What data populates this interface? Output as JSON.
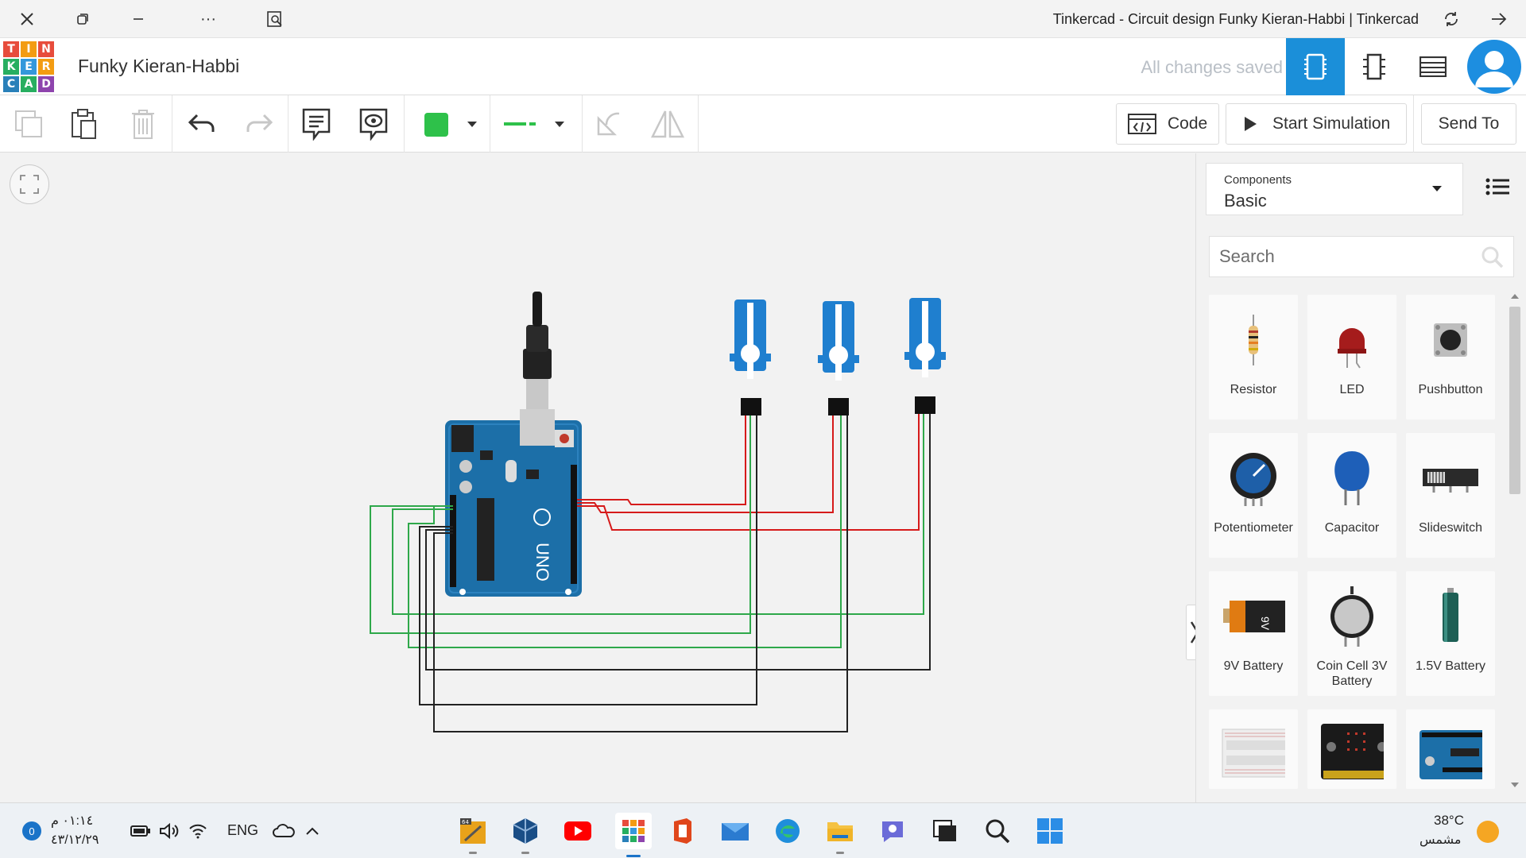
{
  "browser": {
    "title": "Tinkercad - Circuit design Funky Kieran-Habbi | Tinkercad",
    "more_label": "···"
  },
  "header": {
    "logo_letters": [
      "T",
      "I",
      "N",
      "K",
      "E",
      "R",
      "C",
      "A",
      "D"
    ],
    "logo_colors": [
      "#e74c3c",
      "#f39c12",
      "#e74c3c",
      "#27ae60",
      "#3498db",
      "#f39c12",
      "#2980b9",
      "#27ae60",
      "#8e44ad"
    ],
    "project_name": "Funky Kieran-Habbi",
    "save_status": "All changes saved",
    "views": [
      "circuit-view-icon",
      "schematic-view-icon",
      "component-list-icon"
    ],
    "accent": "#1b8fd9"
  },
  "toolbar": {
    "code_label": "Code",
    "simulate_label": "Start Simulation",
    "send_label": "Send To",
    "wire_color": "#2ec14a"
  },
  "panel": {
    "components_label": "Components",
    "category": "Basic",
    "search_placeholder": "Search",
    "items": [
      {
        "label": "Resistor",
        "icon": "resistor-icon"
      },
      {
        "label": "LED",
        "icon": "led-icon"
      },
      {
        "label": "Pushbutton",
        "icon": "pushbutton-icon"
      },
      {
        "label": "Potentiometer",
        "icon": "potentiometer-icon"
      },
      {
        "label": "Capacitor",
        "icon": "capacitor-icon"
      },
      {
        "label": "Slideswitch",
        "icon": "slideswitch-icon"
      },
      {
        "label": "9V Battery",
        "icon": "battery-9v-icon"
      },
      {
        "label": "Coin Cell 3V Battery",
        "icon": "coin-cell-icon"
      },
      {
        "label": "1.5V Battery",
        "icon": "battery-aa-icon"
      },
      {
        "label": "",
        "icon": "breadboard-icon"
      },
      {
        "label": "",
        "icon": "microbit-icon"
      },
      {
        "label": "",
        "icon": "arduino-icon"
      }
    ]
  },
  "canvas": {
    "board_label": "UNO"
  },
  "taskbar": {
    "notification_count": "0",
    "time": "٠١:١٤ م",
    "date": "٤٣/١٢/٢٩",
    "language": "ENG",
    "temperature": "38°C",
    "weather": "مشمس",
    "file_badge": "64"
  }
}
